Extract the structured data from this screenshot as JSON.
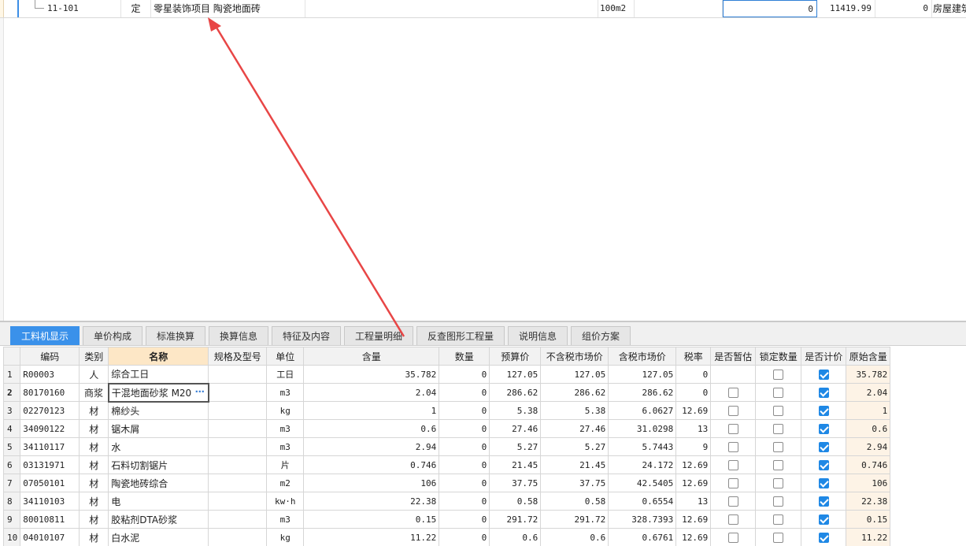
{
  "top_row": {
    "code": "11-101",
    "type": "定",
    "name": "零星装饰项目 陶瓷地面砖",
    "unit": "100m2",
    "quantity": "0",
    "price": "11419.99",
    "total": "0",
    "category": "房屋建筑"
  },
  "tabs": [
    {
      "label": "工料机显示",
      "active": true
    },
    {
      "label": "单价构成",
      "active": false
    },
    {
      "label": "标准换算",
      "active": false
    },
    {
      "label": "换算信息",
      "active": false
    },
    {
      "label": "特征及内容",
      "active": false
    },
    {
      "label": "工程量明细",
      "active": false
    },
    {
      "label": "反查图形工程量",
      "active": false
    },
    {
      "label": "说明信息",
      "active": false
    },
    {
      "label": "组价方案",
      "active": false
    }
  ],
  "table": {
    "headers": [
      "编码",
      "类别",
      "名称",
      "规格及型号",
      "单位",
      "含量",
      "数量",
      "预算价",
      "不含税市场价",
      "含税市场价",
      "税率",
      "是否暂估",
      "锁定数量",
      "是否计价",
      "原始含量"
    ],
    "rows": [
      {
        "n": "1",
        "code": "R00003",
        "cat": "人",
        "name": "综合工日",
        "spec": "",
        "unit": "工日",
        "content": "35.782",
        "qty": "0",
        "budget": "127.05",
        "ex_tax": "127.05",
        "inc_tax": "127.05",
        "tax": "0",
        "est": null,
        "lock": false,
        "priced": true,
        "orig": "35.782"
      },
      {
        "n": "2",
        "code": "80170160",
        "cat": "商浆",
        "name": "干混地面砂浆 M20",
        "spec": "",
        "unit": "m3",
        "content": "2.04",
        "qty": "0",
        "budget": "286.62",
        "ex_tax": "286.62",
        "inc_tax": "286.62",
        "tax": "0",
        "est": false,
        "lock": false,
        "priced": true,
        "orig": "2.04"
      },
      {
        "n": "3",
        "code": "02270123",
        "cat": "材",
        "name": "棉纱头",
        "spec": "",
        "unit": "kg",
        "content": "1",
        "qty": "0",
        "budget": "5.38",
        "ex_tax": "5.38",
        "inc_tax": "6.0627",
        "tax": "12.69",
        "est": false,
        "lock": false,
        "priced": true,
        "orig": "1"
      },
      {
        "n": "4",
        "code": "34090122",
        "cat": "材",
        "name": "锯木屑",
        "spec": "",
        "unit": "m3",
        "content": "0.6",
        "qty": "0",
        "budget": "27.46",
        "ex_tax": "27.46",
        "inc_tax": "31.0298",
        "tax": "13",
        "est": false,
        "lock": false,
        "priced": true,
        "orig": "0.6"
      },
      {
        "n": "5",
        "code": "34110117",
        "cat": "材",
        "name": "水",
        "spec": "",
        "unit": "m3",
        "content": "2.94",
        "qty": "0",
        "budget": "5.27",
        "ex_tax": "5.27",
        "inc_tax": "5.7443",
        "tax": "9",
        "est": false,
        "lock": false,
        "priced": true,
        "orig": "2.94"
      },
      {
        "n": "6",
        "code": "03131971",
        "cat": "材",
        "name": "石料切割锯片",
        "spec": "",
        "unit": "片",
        "content": "0.746",
        "qty": "0",
        "budget": "21.45",
        "ex_tax": "21.45",
        "inc_tax": "24.172",
        "tax": "12.69",
        "est": false,
        "lock": false,
        "priced": true,
        "orig": "0.746"
      },
      {
        "n": "7",
        "code": "07050101",
        "cat": "材",
        "name": "陶瓷地砖综合",
        "spec": "",
        "unit": "m2",
        "content": "106",
        "qty": "0",
        "budget": "37.75",
        "ex_tax": "37.75",
        "inc_tax": "42.5405",
        "tax": "12.69",
        "est": false,
        "lock": false,
        "priced": true,
        "orig": "106"
      },
      {
        "n": "8",
        "code": "34110103",
        "cat": "材",
        "name": "电",
        "spec": "",
        "unit": "kw·h",
        "content": "22.38",
        "qty": "0",
        "budget": "0.58",
        "ex_tax": "0.58",
        "inc_tax": "0.6554",
        "tax": "13",
        "est": false,
        "lock": false,
        "priced": true,
        "orig": "22.38"
      },
      {
        "n": "9",
        "code": "80010811",
        "cat": "材",
        "name": "胶粘剂DTA砂浆",
        "spec": "",
        "unit": "m3",
        "content": "0.15",
        "qty": "0",
        "budget": "291.72",
        "ex_tax": "291.72",
        "inc_tax": "328.7393",
        "tax": "12.69",
        "est": false,
        "lock": false,
        "priced": true,
        "orig": "0.15"
      },
      {
        "n": "10",
        "code": "04010107",
        "cat": "材",
        "name": "白水泥",
        "spec": "",
        "unit": "kg",
        "content": "11.22",
        "qty": "0",
        "budget": "0.6",
        "ex_tax": "0.6",
        "inc_tax": "0.6761",
        "tax": "12.69",
        "est": false,
        "lock": false,
        "priced": true,
        "orig": "11.22"
      }
    ]
  },
  "colors": {
    "accent": "#3a91ea",
    "arrow": "#e84646",
    "header_highlight": "#fde7c6"
  }
}
